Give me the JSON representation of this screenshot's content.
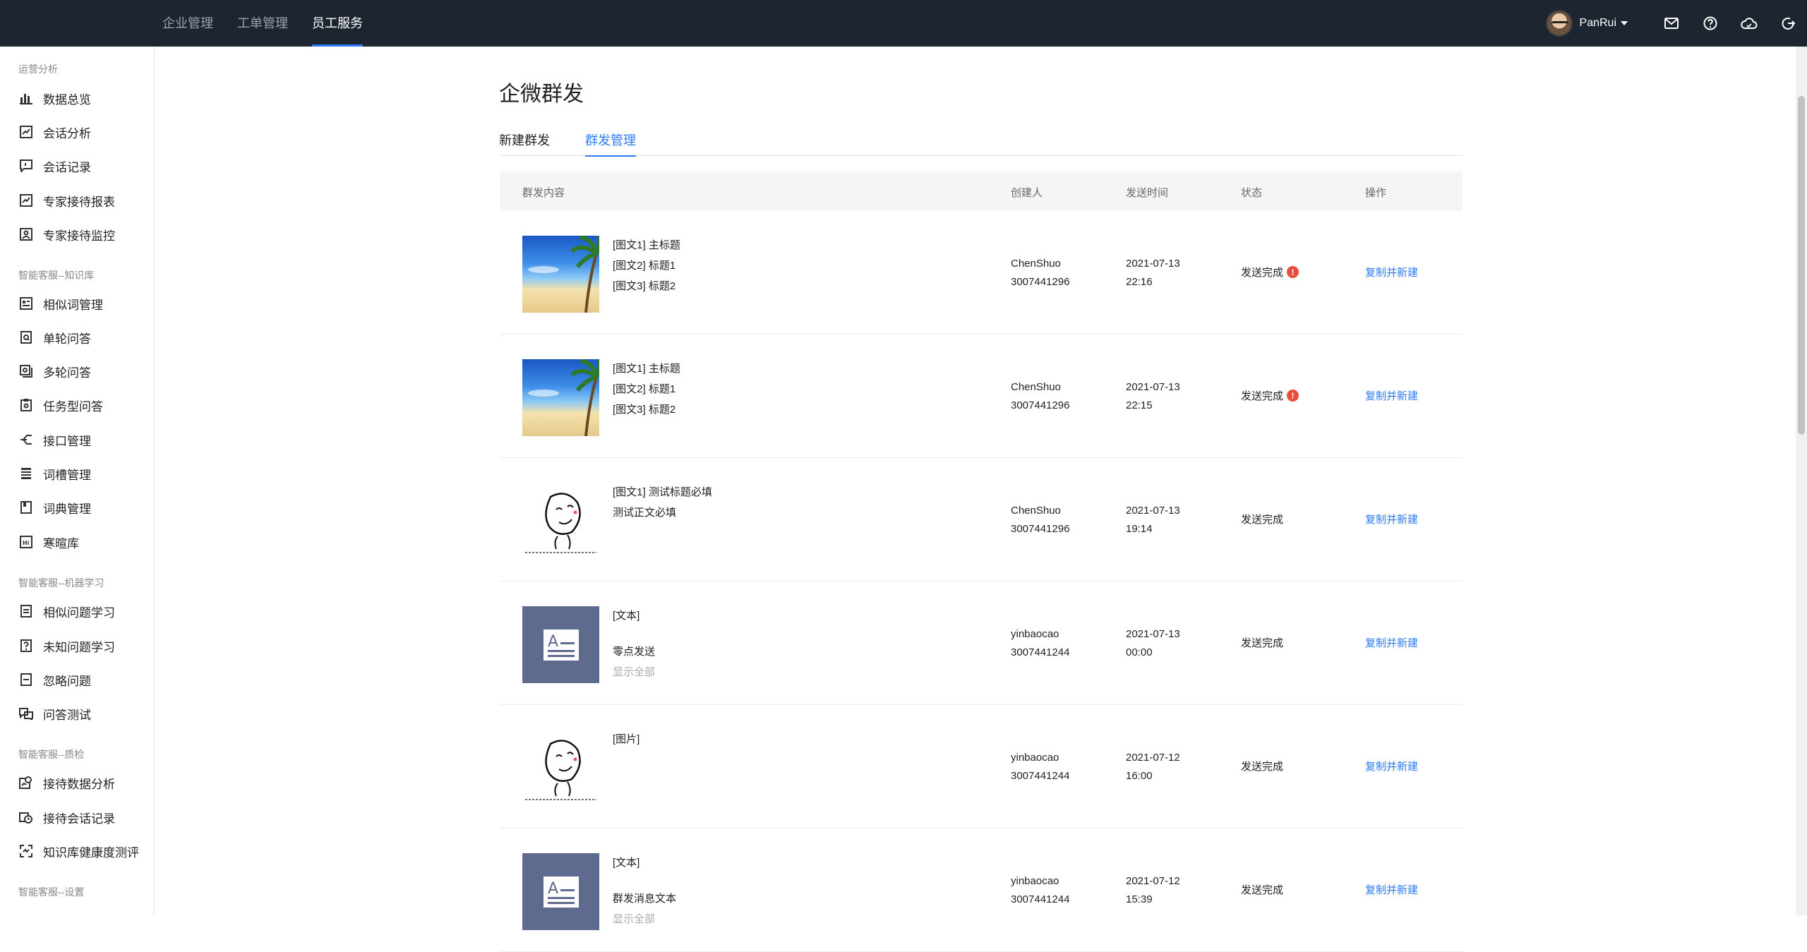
{
  "topnav": {
    "items": [
      {
        "label": "企业管理",
        "active": false
      },
      {
        "label": "工单管理",
        "active": false
      },
      {
        "label": "员工服务",
        "active": true
      }
    ],
    "user": {
      "name": "PanRui"
    },
    "icons": [
      "mail-icon",
      "help-icon",
      "cloud-icon",
      "logout-icon"
    ]
  },
  "sidebar": {
    "sections": [
      {
        "title": "运营分析",
        "items": [
          "数据总览",
          "会话分析",
          "会话记录",
          "专家接待报表",
          "专家接待监控"
        ]
      },
      {
        "title": "智能客服--知识库",
        "items": [
          "相似词管理",
          "单轮问答",
          "多轮问答",
          "任务型问答",
          "接口管理",
          "词槽管理",
          "词典管理",
          "寒暄库"
        ]
      },
      {
        "title": "智能客服--机器学习",
        "items": [
          "相似问题学习",
          "未知问题学习",
          "忽略问题",
          "问答测试"
        ]
      },
      {
        "title": "智能客服--质检",
        "items": [
          "接待数据分析",
          "接待会话记录",
          "知识库健康度测评"
        ]
      },
      {
        "title": "智能客服--设置",
        "items": []
      }
    ]
  },
  "main": {
    "title": "企微群发",
    "tabs": [
      "新建群发",
      "群发管理"
    ],
    "table": {
      "headers": [
        "群发内容",
        "创建人",
        "发送时间",
        "状态",
        "操作"
      ],
      "rows": [
        {
          "thumb": "beach",
          "lines": [
            "[图文1] 主标题",
            "[图文2] 标题1",
            "[图文3] 标题2"
          ],
          "creator": "ChenShuo",
          "creator_id": "3007441296",
          "date": "2021-07-13",
          "time": "22:16",
          "status": "发送完成",
          "warn": "!",
          "op": "复制并新建"
        },
        {
          "thumb": "beach",
          "lines": [
            "[图文1] 主标题",
            "[图文2] 标题1",
            "[图文3] 标题2"
          ],
          "creator": "ChenShuo",
          "creator_id": "3007441296",
          "date": "2021-07-13",
          "time": "22:15",
          "status": "发送完成",
          "warn": "!",
          "op": "复制并新建"
        },
        {
          "thumb": "meme",
          "lines": [
            "[图文1] 测试标题必填",
            "测试正文必填"
          ],
          "creator": "ChenShuo",
          "creator_id": "3007441296",
          "date": "2021-07-13",
          "time": "19:14",
          "status": "发送完成",
          "warn": "",
          "op": "复制并新建"
        },
        {
          "thumb": "doc",
          "lines": [
            "[文本]",
            "",
            "零点发送"
          ],
          "more": "显示全部",
          "creator": "yinbaocao",
          "creator_id": "3007441244",
          "date": "2021-07-13",
          "time": "00:00",
          "status": "发送完成",
          "warn": "",
          "op": "复制并新建"
        },
        {
          "thumb": "meme",
          "lines": [
            "[图片]"
          ],
          "creator": "yinbaocao",
          "creator_id": "3007441244",
          "date": "2021-07-12",
          "time": "16:00",
          "status": "发送完成",
          "warn": "",
          "op": "复制并新建"
        },
        {
          "thumb": "doc",
          "lines": [
            "[文本]",
            "",
            "群发消息文本"
          ],
          "more": "显示全部",
          "creator": "yinbaocao",
          "creator_id": "3007441244",
          "date": "2021-07-12",
          "time": "15:39",
          "status": "发送完成",
          "warn": "",
          "op": "复制并新建"
        }
      ]
    }
  },
  "colors": {
    "accent": "#2d7cf6",
    "topbar": "#1d2530",
    "warn": "#e94e3c"
  }
}
